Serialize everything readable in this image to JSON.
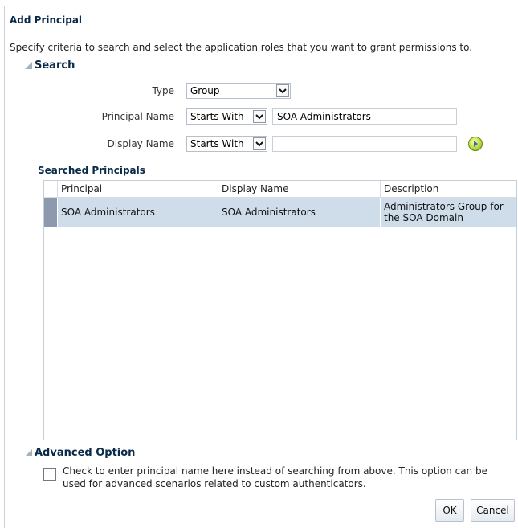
{
  "dialog": {
    "title": "Add Principal",
    "intro": "Specify criteria to search and select the application roles that you want to grant permissions to."
  },
  "search": {
    "header": "Search",
    "type": {
      "label": "Type",
      "value": "Group"
    },
    "principal_name": {
      "label": "Principal Name",
      "operator": "Starts With",
      "value": "SOA Administrators"
    },
    "display_name": {
      "label": "Display Name",
      "operator": "Starts With",
      "value": ""
    }
  },
  "results": {
    "header": "Searched Principals",
    "columns": [
      "Principal",
      "Display Name",
      "Description"
    ],
    "rows": [
      {
        "principal": "SOA Administrators",
        "display_name": "SOA Administrators",
        "description": "Administrators Group for the SOA Domain"
      }
    ]
  },
  "advanced": {
    "header": "Advanced Option",
    "checkbox_text": "Check to enter principal name here instead of searching from above. This option can be used for advanced scenarios related to custom authenticators.",
    "checked": false
  },
  "buttons": {
    "ok": "OK",
    "cancel": "Cancel"
  },
  "icons": {
    "go": "go-arrow-icon",
    "dropdown": "chevron-down-icon",
    "collapse": "disclosure-triangle-icon"
  }
}
